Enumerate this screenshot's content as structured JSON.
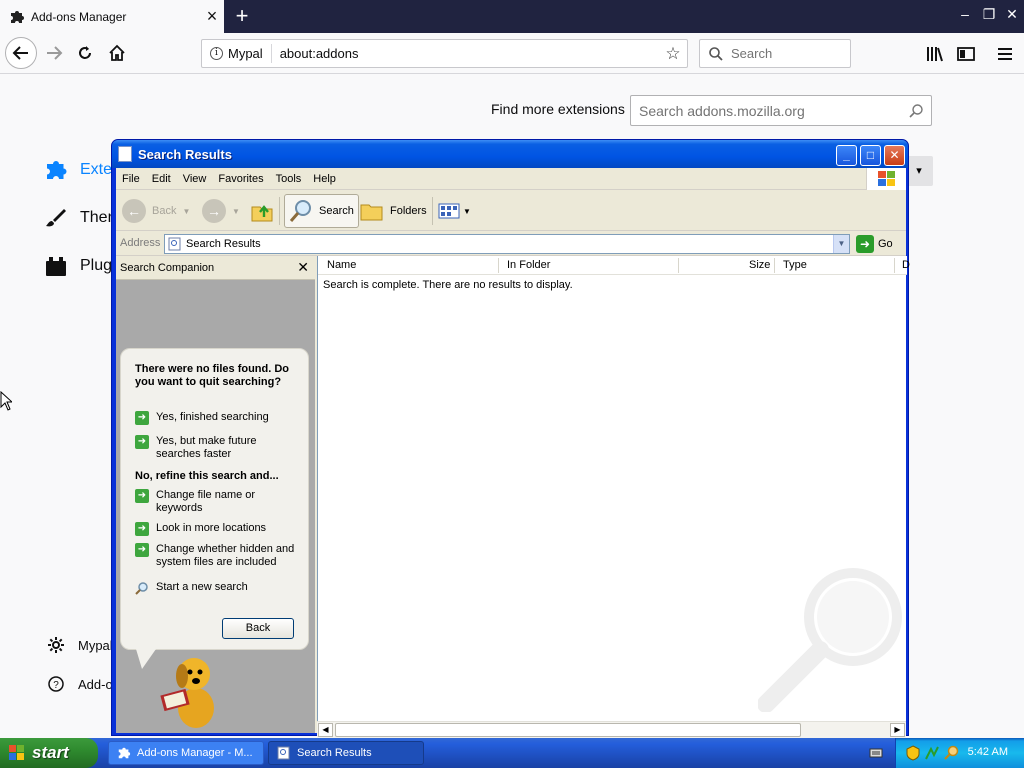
{
  "browser": {
    "tab_title": "Add-ons Manager",
    "identity_label": "Mypal",
    "url": "about:addons",
    "search_placeholder": "Search"
  },
  "addons_page": {
    "find_more_label": "Find more extensions",
    "amo_search_placeholder": "Search addons.mozilla.org",
    "categories": [
      {
        "label": "Exten",
        "icon": "puzzle-icon"
      },
      {
        "label": "Then",
        "icon": "brush-icon"
      },
      {
        "label": "Plugin",
        "icon": "plugin-icon"
      }
    ],
    "footer_items": [
      {
        "label": "Mypal",
        "icon": "gear-icon"
      },
      {
        "label": "Add-o",
        "icon": "help-icon"
      }
    ]
  },
  "search_window": {
    "title": "Search Results",
    "menu": [
      "File",
      "Edit",
      "View",
      "Favorites",
      "Tools",
      "Help"
    ],
    "toolbar": {
      "back": "Back",
      "search": "Search",
      "folders": "Folders"
    },
    "address_label": "Address",
    "address_value": "Search Results",
    "go_label": "Go",
    "companion": {
      "header": "Search Companion",
      "question": "There were no files found. Do you want to quit searching?",
      "options_top": [
        "Yes, finished searching",
        "Yes, but make future searches faster"
      ],
      "refine_heading": "No, refine this search and...",
      "options_refine": [
        "Change file name or keywords",
        "Look in more locations",
        "Change whether hidden and system files are included"
      ],
      "new_search": "Start a new search",
      "back_button": "Back"
    },
    "columns": [
      "Name",
      "In Folder",
      "Size",
      "Type",
      "D"
    ],
    "empty_message": "Search is complete. There are no results to display."
  },
  "taskbar": {
    "start_label": "start",
    "items": [
      "Add-ons Manager - M...",
      "Search Results"
    ],
    "clock": "5:42 AM"
  }
}
